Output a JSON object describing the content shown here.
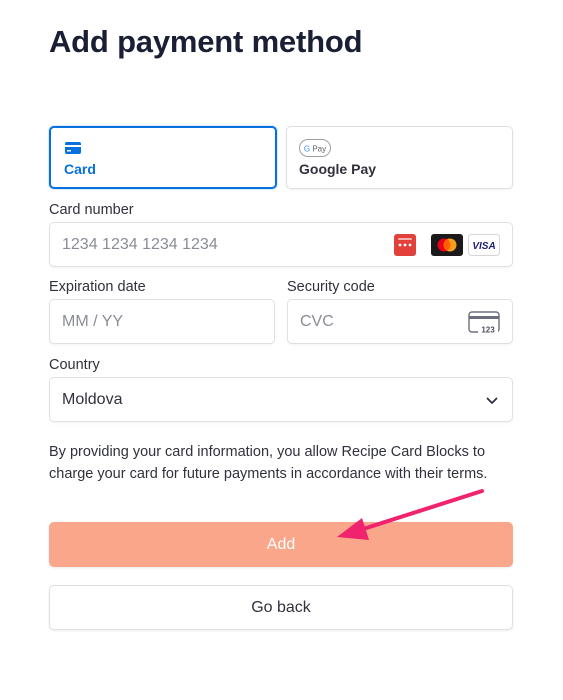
{
  "page": {
    "title": "Add payment method"
  },
  "tabs": [
    {
      "label": "Card",
      "icon": "credit-card-icon",
      "selected": true
    },
    {
      "label": "Google Pay",
      "icon": "google-pay-icon",
      "badge": "G Pay",
      "selected": false
    }
  ],
  "card_number": {
    "label": "Card number",
    "placeholder": "1234 1234 1234 1234",
    "brands": [
      "unionpay-icon",
      "mastercard-icon",
      "visa-icon"
    ],
    "visa_text": "VISA"
  },
  "expiration": {
    "label": "Expiration date",
    "placeholder": "MM / YY"
  },
  "security": {
    "label": "Security code",
    "placeholder": "CVC",
    "icon_text": "123"
  },
  "country": {
    "label": "Country",
    "value": "Moldova"
  },
  "terms": "By providing your card information, you allow Recipe Card Blocks to charge your card for future payments in accordance with their terms.",
  "buttons": {
    "add": "Add",
    "back": "Go back"
  },
  "colors": {
    "accent": "#0570de",
    "add_button": "#f9a68a",
    "annotation_arrow": "#f0246e"
  }
}
